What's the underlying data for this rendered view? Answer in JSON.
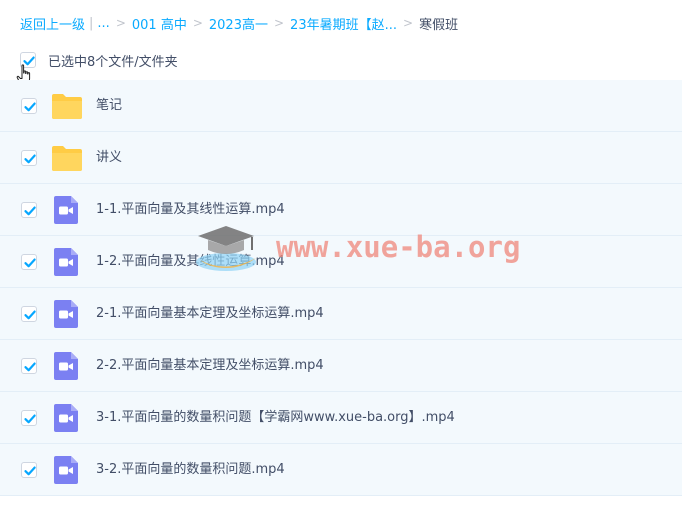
{
  "breadcrumb": {
    "back": "返回上一级",
    "ellipsis": "...",
    "items": [
      "001 高中",
      "2023高一",
      "23年暑期班【赵..."
    ],
    "current": "寒假班"
  },
  "selection": {
    "label": "已选中8个文件/文件夹"
  },
  "files": [
    {
      "name": "笔记",
      "type": "folder"
    },
    {
      "name": "讲义",
      "type": "folder"
    },
    {
      "name": "1-1.平面向量及其线性运算.mp4",
      "type": "video"
    },
    {
      "name": "1-2.平面向量及其线性运算.mp4",
      "type": "video"
    },
    {
      "name": "2-1.平面向量基本定理及坐标运算.mp4",
      "type": "video"
    },
    {
      "name": "2-2.平面向量基本定理及坐标运算.mp4",
      "type": "video"
    },
    {
      "name": "3-1.平面向量的数量积问题【学霸网www.xue-ba.org】.mp4",
      "type": "video"
    },
    {
      "name": "3-2.平面向量的数量积问题.mp4",
      "type": "video"
    }
  ],
  "watermark": {
    "text": "www.xue-ba.org"
  },
  "colors": {
    "accent": "#09aaff",
    "checkbox": "#06a7ff",
    "folder": "#ffcc45",
    "video": "#7b80f2",
    "row_bg": "#f3f9fd"
  }
}
